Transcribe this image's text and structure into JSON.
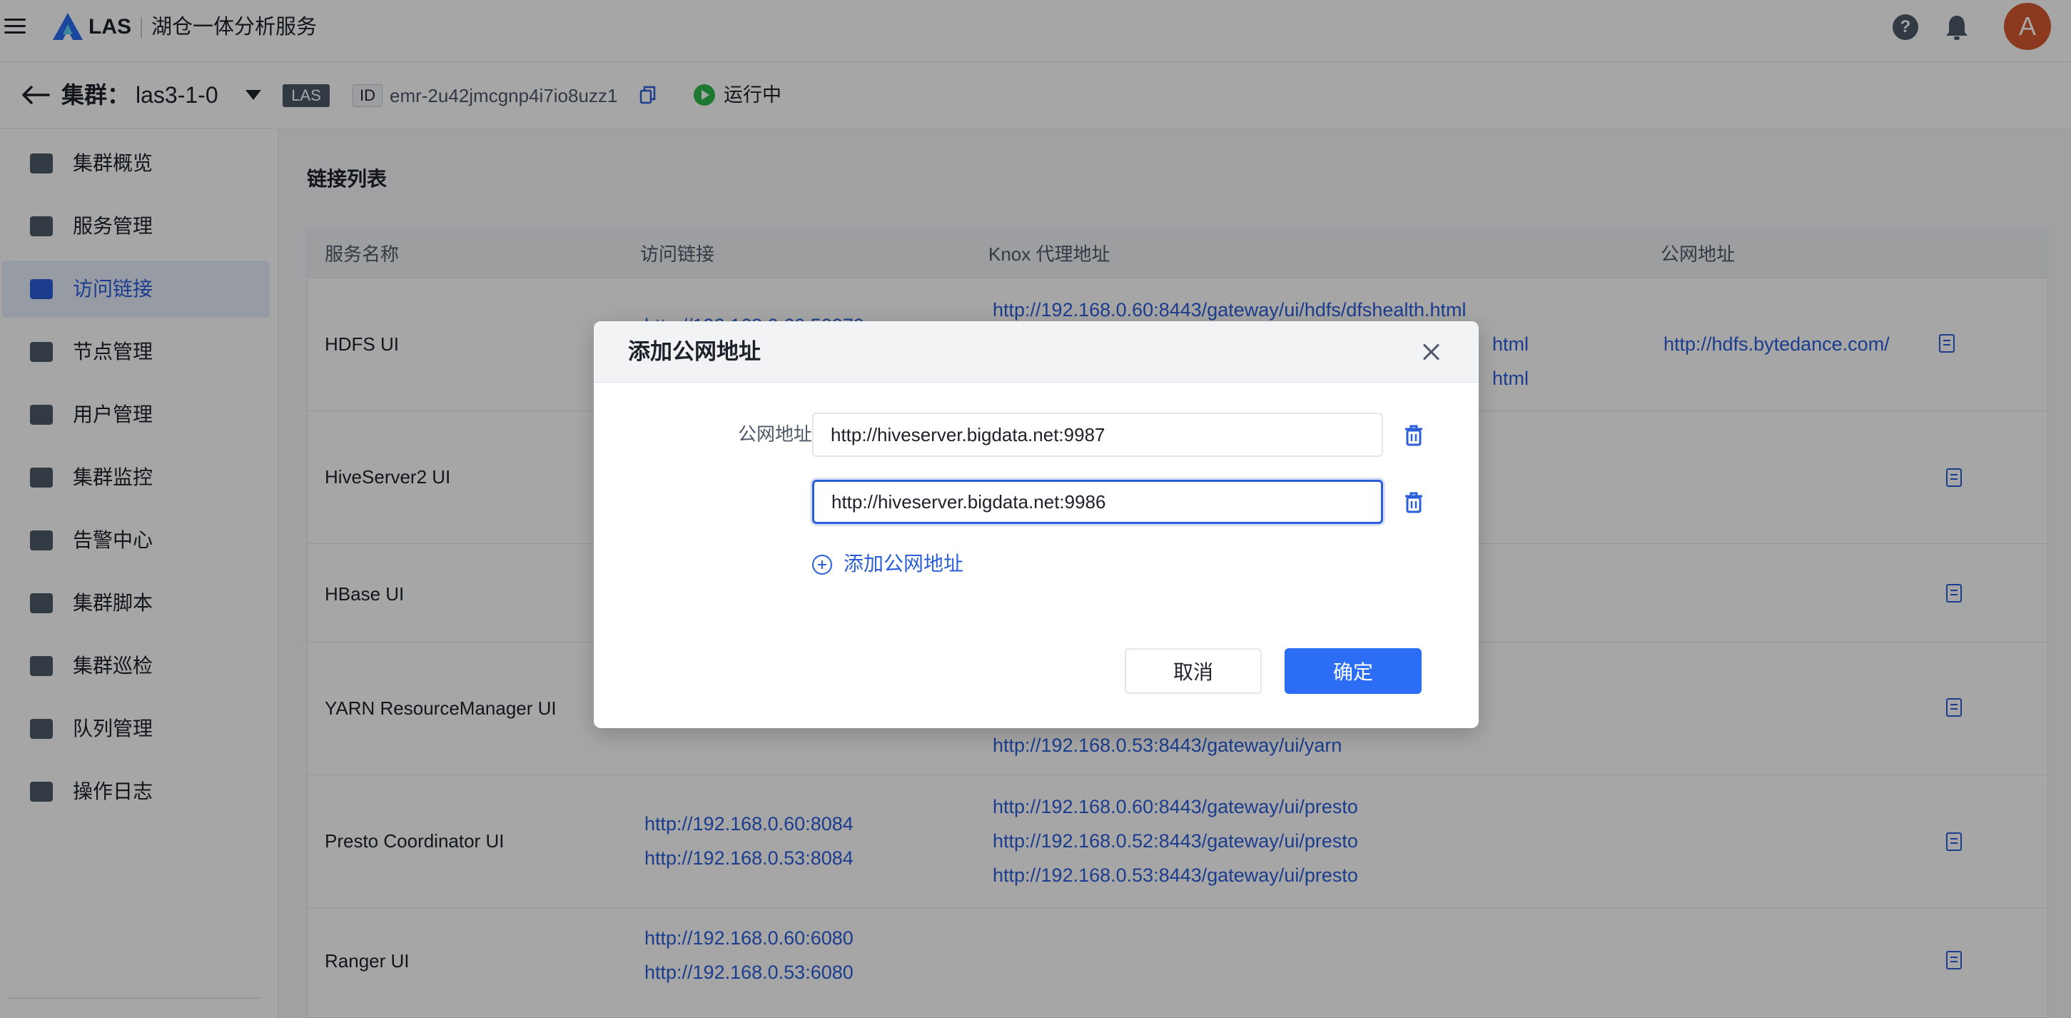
{
  "topbar": {
    "brand": "LAS",
    "product": "湖仓一体分析服务",
    "avatar_letter": "A",
    "icons": [
      "menu-icon",
      "las-logo-icon",
      "help-icon",
      "bell-icon"
    ]
  },
  "cluster": {
    "label": "集群：",
    "name": "las3-1-0",
    "tag": "LAS",
    "id_label": "ID",
    "id_value": "emr-2u42jmcgnp4i7io8uzz1",
    "status": "运行中",
    "status_color": "#2db84d"
  },
  "sidebar": {
    "items": [
      {
        "label": "集群概览",
        "icon": "bar-chart-icon"
      },
      {
        "label": "服务管理",
        "icon": "service-icon"
      },
      {
        "label": "访问链接",
        "icon": "link-play-icon",
        "active": true
      },
      {
        "label": "节点管理",
        "icon": "nodes-icon"
      },
      {
        "label": "用户管理",
        "icon": "user-icon"
      },
      {
        "label": "集群监控",
        "icon": "monitor-icon"
      },
      {
        "label": "告警中心",
        "icon": "alarm-icon"
      },
      {
        "label": "集群脚本",
        "icon": "script-icon"
      },
      {
        "label": "集群巡检",
        "icon": "inspect-icon"
      },
      {
        "label": "队列管理",
        "icon": "queue-icon"
      },
      {
        "label": "操作日志",
        "icon": "log-icon"
      }
    ]
  },
  "main": {
    "section_title": "链接列表",
    "columns": [
      "服务名称",
      "访问链接",
      "Knox 代理地址",
      "公网地址"
    ],
    "rows": [
      {
        "name": "HDFS UI",
        "access": [
          "http://192.168.0.60:50070"
        ],
        "knox": [
          "http://192.168.0.60:8443/gateway/ui/hdfs/dfshealth.html",
          "html",
          "html"
        ],
        "public": "http://hdfs.bytedance.com/"
      },
      {
        "name": "HiveServer2 UI",
        "access": [],
        "knox": [],
        "public": ""
      },
      {
        "name": "HBase UI",
        "access": [],
        "knox": [],
        "public": ""
      },
      {
        "name": "YARN ResourceManager UI",
        "access": [],
        "knox": [
          "http://192.168.0.53:8443/gateway/ui/yarn"
        ],
        "public": ""
      },
      {
        "name": "Presto Coordinator UI",
        "access": [
          "http://192.168.0.60:8084",
          "http://192.168.0.53:8084"
        ],
        "knox": [
          "http://192.168.0.60:8443/gateway/ui/presto",
          "http://192.168.0.52:8443/gateway/ui/presto",
          "http://192.168.0.53:8443/gateway/ui/presto"
        ],
        "public": ""
      },
      {
        "name": "Ranger UI",
        "access": [
          "http://192.168.0.60:6080",
          "http://192.168.0.53:6080"
        ],
        "knox": [],
        "public": ""
      }
    ]
  },
  "modal": {
    "title": "添加公网地址",
    "field_label": "公网地址",
    "inputs": [
      "http://hiveserver.bigdata.net:9987",
      "http://hiveserver.bigdata.net:9986"
    ],
    "add_label": "添加公网地址",
    "cancel_label": "取消",
    "ok_label": "确定",
    "accent_color": "#2b6df5"
  }
}
